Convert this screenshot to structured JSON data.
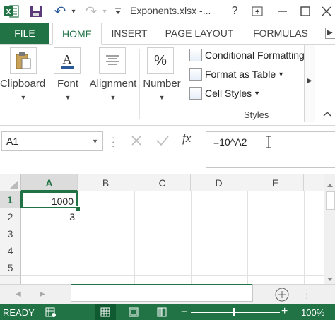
{
  "window": {
    "title": "Exponents.xlsx -...",
    "help": "?",
    "restore_glyph": "⧉",
    "minimize_glyph": "—",
    "maximize_glyph": "☐"
  },
  "qat": {
    "undo_glyph": "↶",
    "redo_glyph": "↷",
    "dropdown_glyph": "▾"
  },
  "ribbon_tabs": [
    "FILE",
    "HOME",
    "INSERT",
    "PAGE LAYOUT",
    "FORMULAS"
  ],
  "ribbon": {
    "clipboard": "Clipboard",
    "font": "Font",
    "font_icon_letter": "A",
    "alignment": "Alignment",
    "number": "Number",
    "number_icon": "%",
    "styles": {
      "conditional": "Conditional Formatting",
      "format_table": "Format as Table",
      "cell_styles": "Cell Styles",
      "group_label": "Styles"
    }
  },
  "formula_bar": {
    "name_box": "A1",
    "formula": "=10^A2",
    "fx": "fx"
  },
  "grid": {
    "columns": [
      "A",
      "B",
      "C",
      "D",
      "E"
    ],
    "rows": [
      "1",
      "2",
      "3",
      "4",
      "5"
    ],
    "cells": {
      "A1": "1000",
      "A2": "3"
    }
  },
  "statusbar": {
    "mode": "READY",
    "zoom": "100%",
    "zoom_minus": "−",
    "zoom_plus": "+"
  },
  "colors": {
    "excel_green": "#217346"
  }
}
